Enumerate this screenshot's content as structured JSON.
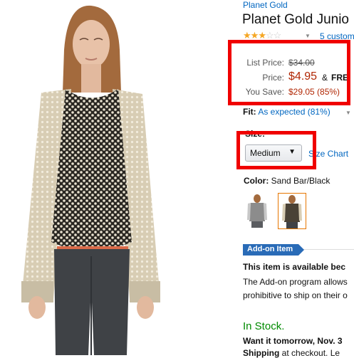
{
  "brand": "Planet Gold",
  "title": "Planet Gold Junio",
  "rating": {
    "stars_filled": 2.5,
    "stars_total": 5,
    "reviews": "5 custom"
  },
  "prices": {
    "list_label": "List Price:",
    "list_value": "$34.00",
    "price_label": "Price:",
    "price_value": "$4.95",
    "amp": "&",
    "free": "FRE",
    "save_label": "You Save:",
    "save_value": "$29.05 (85%)"
  },
  "fit": {
    "label": "Fit:",
    "value": "As expected (81%)"
  },
  "size": {
    "label": "Size:",
    "selected": "Medium",
    "chart_link": "Size Chart"
  },
  "color": {
    "label": "Color:",
    "value": "Sand Bar/Black"
  },
  "addon": {
    "badge": "Add-on Item",
    "headline": "This item is available bec",
    "line1": "The Add-on program allows",
    "line2": "prohibitive to ship on their o"
  },
  "stock": "In Stock.",
  "delivery": "Want it tomorrow, Nov. 3",
  "shipping": {
    "bold": "Shipping",
    "rest": "at checkout. Le"
  },
  "colors": {
    "link": "#0066c0",
    "price": "#b12704",
    "stock": "#008a00",
    "highlight": "#f00000",
    "badge": "#296bb7"
  }
}
